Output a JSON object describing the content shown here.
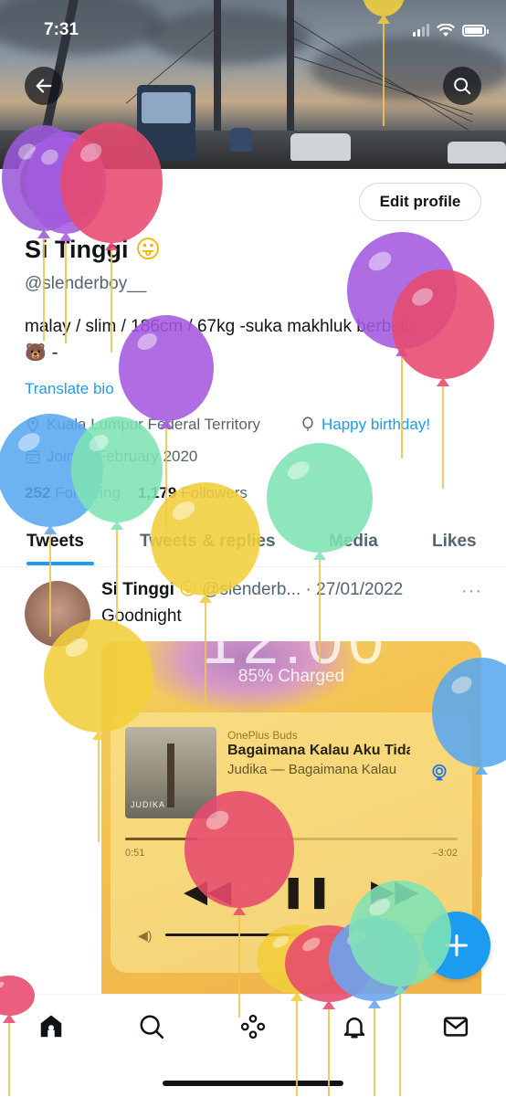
{
  "status_bar": {
    "time": "7:31"
  },
  "profile": {
    "name": "Si Tinggi",
    "name_emoji": "😛",
    "handle": "@slenderboy__",
    "bio_line1": "malay / slim / 186cm / 67kg -suka makhluk berbulu",
    "bio_line2": "🐻 -",
    "translate": "Translate bio",
    "location": "Kuala Lumpur Federal Territory",
    "birthday": "Happy birthday!",
    "joined": "Joined February 2020",
    "following_count": "252",
    "following_label": "Following",
    "followers_count": "1,179",
    "followers_label": "Followers",
    "edit_button": "Edit profile"
  },
  "tabs": [
    {
      "label": "Tweets",
      "active": true
    },
    {
      "label": "Tweets & replies",
      "active": false
    },
    {
      "label": "Media",
      "active": false
    },
    {
      "label": "Likes",
      "active": false
    }
  ],
  "tweet": {
    "name": "Si Tinggi",
    "emoji": "😛",
    "handle_date": "@slenderb... · 27/01/2022",
    "more": "···",
    "text": "Goodnight",
    "media": {
      "lock_clock": "12:00",
      "charge": "85% Charged",
      "source": "OnePlus Buds",
      "song": "Bagaimana Kalau Aku Tidak",
      "artist": "Judika — Bagaimana Kalau A",
      "album_text": "JUDIKA",
      "elapsed": "0:51",
      "remaining": "–3:02",
      "progress": 0.22,
      "volume": 0.45
    }
  },
  "colors": {
    "accent": "#1d9bf0",
    "text": "#0f1419",
    "muted": "#536471"
  },
  "icons": [
    "back-arrow-icon",
    "search-icon",
    "location-icon",
    "balloon-icon",
    "calendar-icon",
    "home-icon",
    "explore-icon",
    "spaces-icon",
    "bell-icon",
    "mail-icon",
    "compose-plus-icon"
  ]
}
